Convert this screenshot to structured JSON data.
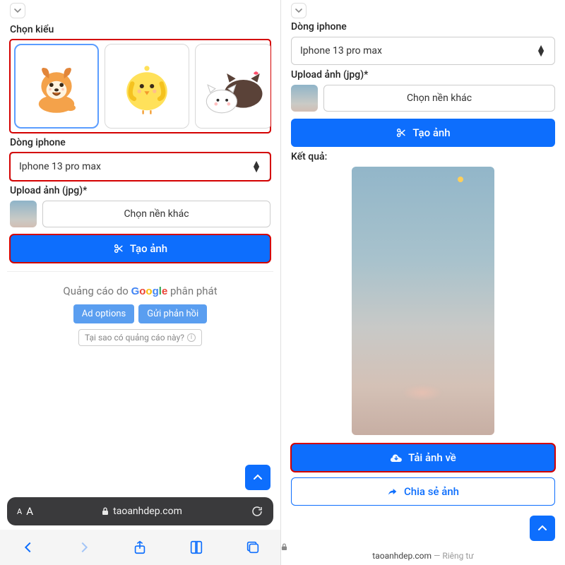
{
  "left": {
    "choose_style_label": "Chọn kiểu",
    "iphone_section_label": "Dòng iphone",
    "iphone_selected": "Iphone 13 pro max",
    "upload_label": "Upload ảnh (jpg)*",
    "choose_bg_label": "Chọn nền khác",
    "create_label": "Tạo ảnh",
    "ads": {
      "prefix": "Quảng cáo do ",
      "suffix": " phân phát",
      "ad_options": "Ad options",
      "send_feedback": "Gửi phản hồi",
      "why_ad": "Tại sao có quảng cáo này?"
    },
    "url_aa": "AA",
    "url_domain": "taoanhdep.com"
  },
  "right": {
    "iphone_section_label": "Dòng iphone",
    "iphone_selected": "Iphone 13 pro max",
    "upload_label": "Upload ảnh (jpg)*",
    "choose_bg_label": "Chọn nền khác",
    "create_label": "Tạo ảnh",
    "result_label": "Kết quả:",
    "download_label": "Tải ảnh về",
    "share_label": "Chia sẻ ảnh",
    "footer_domain": "taoanhdep.com",
    "footer_privacy": " — Riêng tư"
  }
}
